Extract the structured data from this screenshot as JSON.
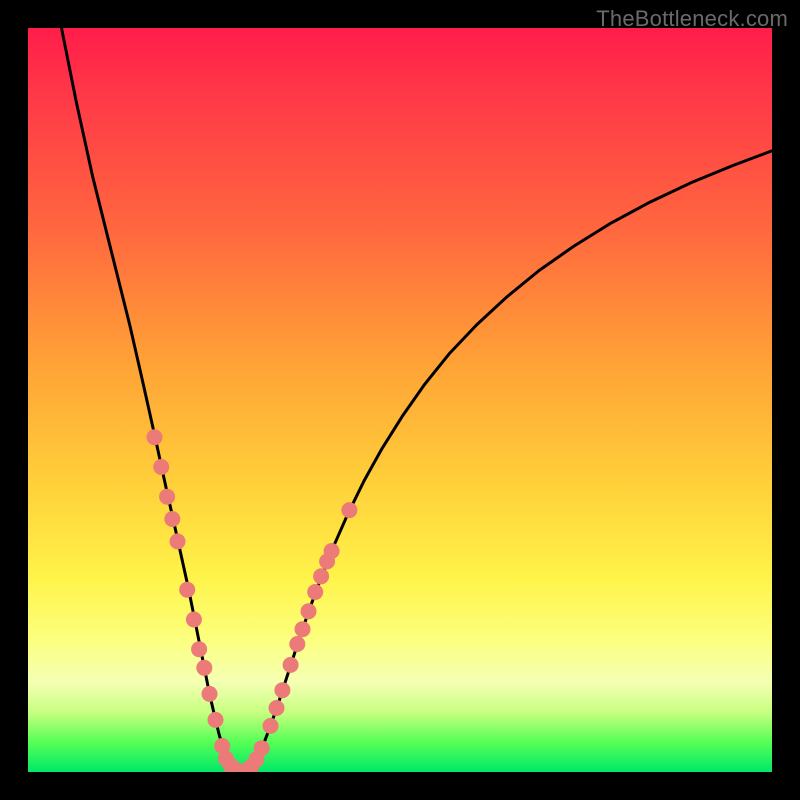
{
  "watermark": "TheBottleneck.com",
  "colors": {
    "curve_stroke": "#000000",
    "dot_fill": "#ec7a78",
    "dot_stroke": "#d86a68"
  },
  "chart_data": {
    "type": "line",
    "title": "",
    "xlabel": "",
    "ylabel": "",
    "xlim": [
      0,
      100
    ],
    "ylim": [
      0,
      100
    ],
    "note": "No axis ticks or numeric labels are rendered on the chart; curve and dot coordinates are in 0–100 normalized space matching the plot area.",
    "series": [
      {
        "name": "left-curve",
        "values_xy": [
          [
            4.5,
            100.0
          ],
          [
            6.5,
            90.0
          ],
          [
            8.7,
            80.0
          ],
          [
            11.2,
            70.0
          ],
          [
            13.7,
            60.0
          ],
          [
            15.3,
            53.0
          ],
          [
            16.3,
            48.5
          ],
          [
            17.3,
            44.0
          ],
          [
            18.5,
            38.5
          ],
          [
            19.5,
            34.0
          ],
          [
            20.5,
            29.5
          ],
          [
            21.6,
            24.5
          ],
          [
            22.4,
            20.5
          ],
          [
            23.1,
            17.0
          ],
          [
            23.8,
            13.5
          ],
          [
            24.4,
            10.5
          ],
          [
            25.1,
            7.5
          ],
          [
            25.7,
            5.0
          ],
          [
            26.3,
            3.0
          ],
          [
            27.0,
            1.5
          ],
          [
            27.9,
            0.4
          ],
          [
            28.8,
            0.0
          ]
        ]
      },
      {
        "name": "right-curve",
        "values_xy": [
          [
            28.8,
            0.0
          ],
          [
            29.7,
            0.4
          ],
          [
            30.6,
            1.6
          ],
          [
            31.6,
            3.6
          ],
          [
            32.6,
            6.2
          ],
          [
            33.7,
            9.4
          ],
          [
            35.0,
            13.4
          ],
          [
            36.3,
            17.4
          ],
          [
            37.8,
            21.8
          ],
          [
            39.4,
            26.1
          ],
          [
            41.1,
            30.4
          ],
          [
            43.0,
            34.7
          ],
          [
            45.2,
            39.2
          ],
          [
            47.6,
            43.5
          ],
          [
            50.3,
            47.8
          ],
          [
            53.3,
            52.1
          ],
          [
            56.6,
            56.2
          ],
          [
            60.3,
            60.1
          ],
          [
            64.3,
            63.8
          ],
          [
            68.7,
            67.4
          ],
          [
            73.4,
            70.7
          ],
          [
            78.4,
            73.8
          ],
          [
            83.6,
            76.6
          ],
          [
            89.1,
            79.2
          ],
          [
            94.7,
            81.5
          ],
          [
            100.0,
            83.5
          ]
        ]
      }
    ],
    "dots": [
      [
        17.0,
        45.0
      ],
      [
        17.9,
        41.0
      ],
      [
        18.7,
        37.0
      ],
      [
        19.4,
        34.0
      ],
      [
        20.1,
        31.0
      ],
      [
        21.4,
        24.5
      ],
      [
        22.3,
        20.5
      ],
      [
        23.0,
        16.5
      ],
      [
        23.7,
        14.0
      ],
      [
        24.4,
        10.5
      ],
      [
        25.2,
        7.0
      ],
      [
        26.1,
        3.5
      ],
      [
        26.6,
        1.8
      ],
      [
        27.2,
        0.9
      ],
      [
        27.9,
        0.3
      ],
      [
        28.6,
        0.0
      ],
      [
        29.3,
        0.2
      ],
      [
        30.0,
        0.7
      ],
      [
        30.7,
        1.7
      ],
      [
        31.4,
        3.2
      ],
      [
        32.6,
        6.2
      ],
      [
        33.4,
        8.6
      ],
      [
        34.2,
        11.0
      ],
      [
        35.3,
        14.4
      ],
      [
        36.2,
        17.2
      ],
      [
        36.9,
        19.2
      ],
      [
        37.7,
        21.6
      ],
      [
        38.6,
        24.2
      ],
      [
        39.4,
        26.3
      ],
      [
        40.2,
        28.3
      ],
      [
        40.8,
        29.7
      ],
      [
        43.2,
        35.2
      ]
    ]
  }
}
